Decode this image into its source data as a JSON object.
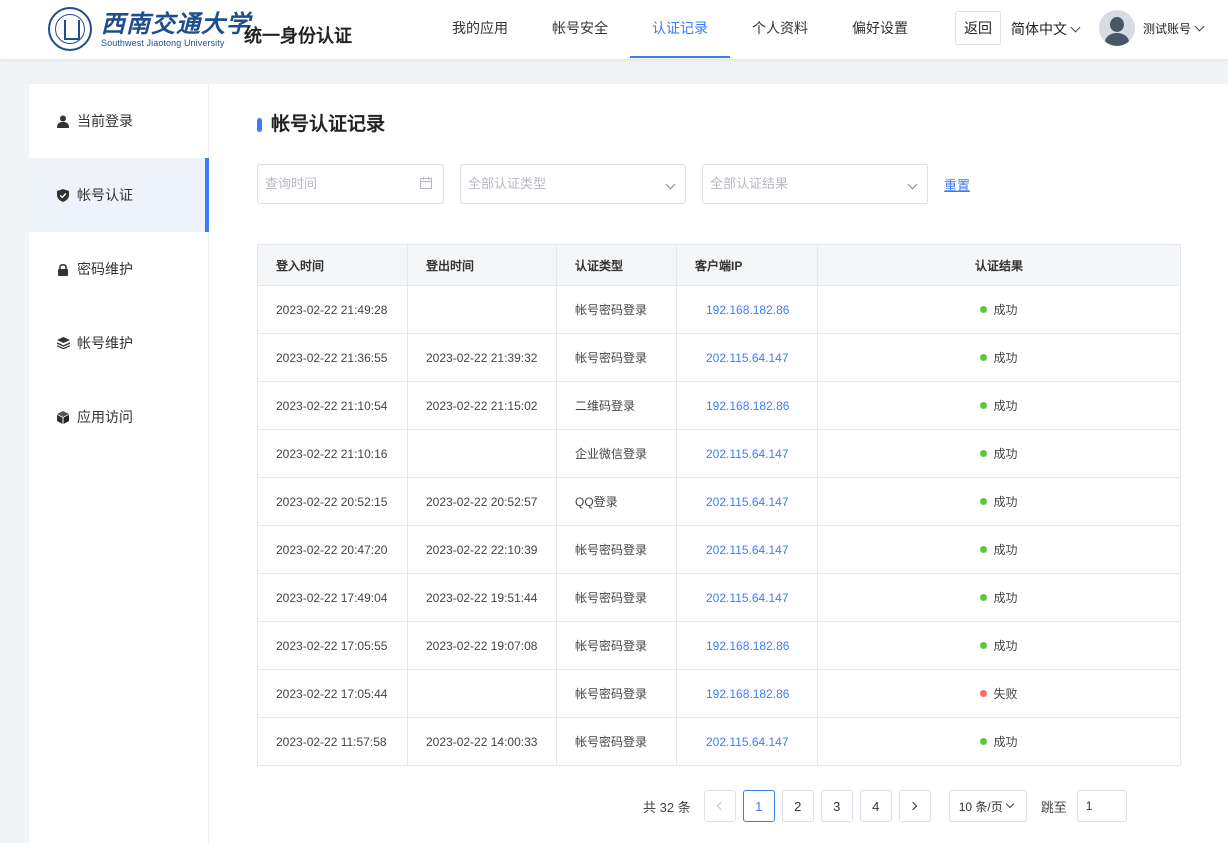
{
  "header": {
    "logo_cn": "西南交通大学",
    "logo_en": "Southwest Jiaotong University",
    "site_title": "统一身份认证",
    "nav": [
      "我的应用",
      "帐号安全",
      "认证记录",
      "个人资料",
      "偏好设置"
    ],
    "nav_active": "认证记录",
    "back_label": "返回",
    "language": "简体中文",
    "user_name": "测试账号"
  },
  "sidebar": {
    "items": [
      {
        "label": "当前登录",
        "icon": "user-icon"
      },
      {
        "label": "帐号认证",
        "icon": "shield-check-icon"
      },
      {
        "label": "密码维护",
        "icon": "lock-icon"
      },
      {
        "label": "帐号维护",
        "icon": "layers-icon"
      },
      {
        "label": "应用访问",
        "icon": "cube-icon"
      }
    ],
    "active": "帐号认证"
  },
  "main": {
    "title": "帐号认证记录",
    "filters": {
      "time_placeholder": "查询时间",
      "type_placeholder": "全部认证类型",
      "result_placeholder": "全部认证结果",
      "reset_label": "重置"
    },
    "table": {
      "columns": [
        "登入时间",
        "登出时间",
        "认证类型",
        "客户端IP",
        "认证结果"
      ],
      "rows": [
        {
          "login": "2023-02-22 21:49:28",
          "logout": "",
          "type": "帐号密码登录",
          "ip": "192.168.182.86",
          "result": "成功"
        },
        {
          "login": "2023-02-22 21:36:55",
          "logout": "2023-02-22 21:39:32",
          "type": "帐号密码登录",
          "ip": "202.115.64.147",
          "result": "成功"
        },
        {
          "login": "2023-02-22 21:10:54",
          "logout": "2023-02-22 21:15:02",
          "type": "二维码登录",
          "ip": "192.168.182.86",
          "result": "成功"
        },
        {
          "login": "2023-02-22 21:10:16",
          "logout": "",
          "type": "企业微信登录",
          "ip": "202.115.64.147",
          "result": "成功"
        },
        {
          "login": "2023-02-22 20:52:15",
          "logout": "2023-02-22 20:52:57",
          "type": "QQ登录",
          "ip": "202.115.64.147",
          "result": "成功"
        },
        {
          "login": "2023-02-22 20:47:20",
          "logout": "2023-02-22 22:10:39",
          "type": "帐号密码登录",
          "ip": "202.115.64.147",
          "result": "成功"
        },
        {
          "login": "2023-02-22 17:49:04",
          "logout": "2023-02-22 19:51:44",
          "type": "帐号密码登录",
          "ip": "202.115.64.147",
          "result": "成功"
        },
        {
          "login": "2023-02-22 17:05:55",
          "logout": "2023-02-22 19:07:08",
          "type": "帐号密码登录",
          "ip": "192.168.182.86",
          "result": "成功"
        },
        {
          "login": "2023-02-22 17:05:44",
          "logout": "",
          "type": "帐号密码登录",
          "ip": "192.168.182.86",
          "result": "失败"
        },
        {
          "login": "2023-02-22 11:57:58",
          "logout": "2023-02-22 14:00:33",
          "type": "帐号密码登录",
          "ip": "202.115.64.147",
          "result": "成功"
        }
      ]
    },
    "pagination": {
      "total_text": "共 32 条",
      "pages": [
        "1",
        "2",
        "3",
        "4"
      ],
      "current": "1",
      "page_size": "10 条/页",
      "jump_label": "跳至",
      "jump_value": "1"
    }
  },
  "colors": {
    "accent": "#3e7bfa",
    "success": "#67c23a",
    "failure": "#f56c6c",
    "brand": "#1f4e8c"
  }
}
